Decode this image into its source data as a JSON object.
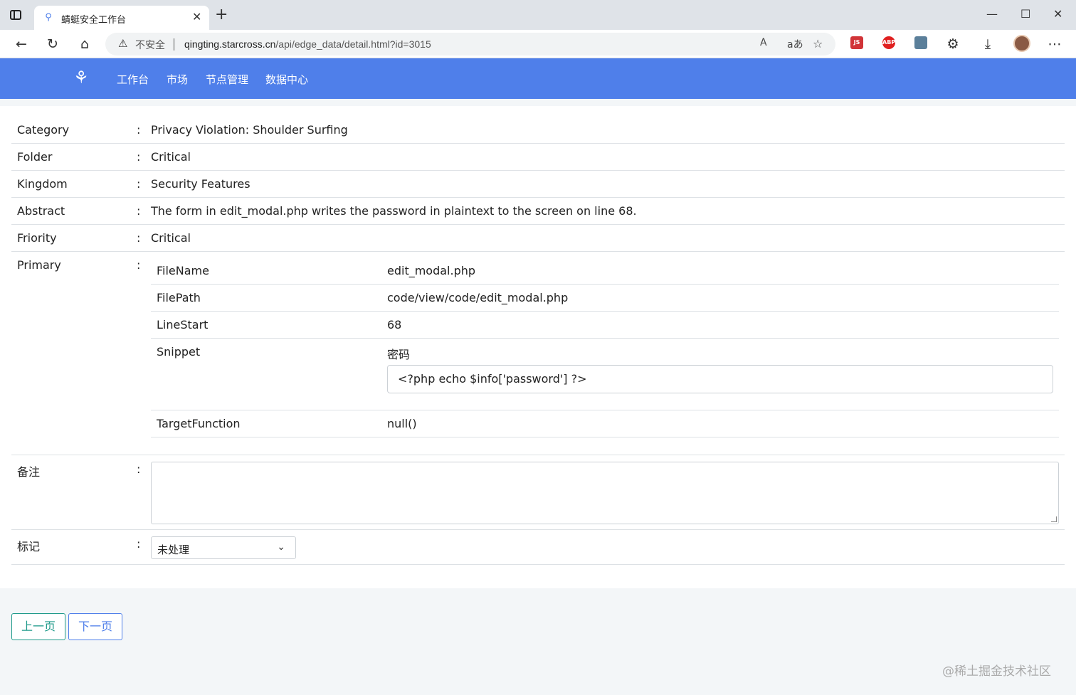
{
  "browser": {
    "tab_title": "蜻蜓安全工作台",
    "tab_favicon": "dragonfly-icon",
    "address": {
      "insecure_label": "不安全",
      "url_host": "qingting.starcross.cn",
      "url_path": "/api/edge_data/detail.html?id=3015"
    },
    "read_aloud_glyph": "A",
    "translate_glyph": "aあ",
    "extensions": [
      {
        "name": "js-extension",
        "label": "JS",
        "color": "#d13438"
      },
      {
        "name": "adblock-extension",
        "label": "ABP",
        "color": "#e02020"
      },
      {
        "name": "page-extension",
        "label": "",
        "color": "#5b7f9a"
      }
    ]
  },
  "nav": {
    "items": [
      "工作台",
      "市场",
      "节点管理",
      "数据中心"
    ]
  },
  "detail": {
    "rows": [
      {
        "label": "Category",
        "value": "Privacy Violation: Shoulder Surfing"
      },
      {
        "label": "Folder",
        "value": "Critical"
      },
      {
        "label": "Kingdom",
        "value": "Security Features"
      },
      {
        "label": "Abstract",
        "value": "The form in edit_modal.php writes the password in plaintext to the screen on line 68."
      },
      {
        "label": "Friority",
        "value": "Critical"
      }
    ],
    "colon": ":",
    "primary": {
      "label": "Primary",
      "fields": [
        {
          "key": "FileName",
          "value": "edit_modal.php"
        },
        {
          "key": "FilePath",
          "value": "code/view/code/edit_modal.php"
        },
        {
          "key": "LineStart",
          "value": "68"
        },
        {
          "key": "Snippet",
          "value": "密码",
          "code": "<?php echo $info['password'] ?>"
        },
        {
          "key": "TargetFunction",
          "value": "null()"
        }
      ]
    },
    "note_label": "备注",
    "note_value": "",
    "mark_label": "标记",
    "mark_value": "未处理"
  },
  "pager": {
    "prev": "上一页",
    "next": "下一页"
  },
  "watermark": "@稀土掘金技术社区",
  "colors": {
    "navbar": "#4f7fea",
    "prev_button": "#1f9a8a",
    "next_button": "#4f7fea"
  }
}
